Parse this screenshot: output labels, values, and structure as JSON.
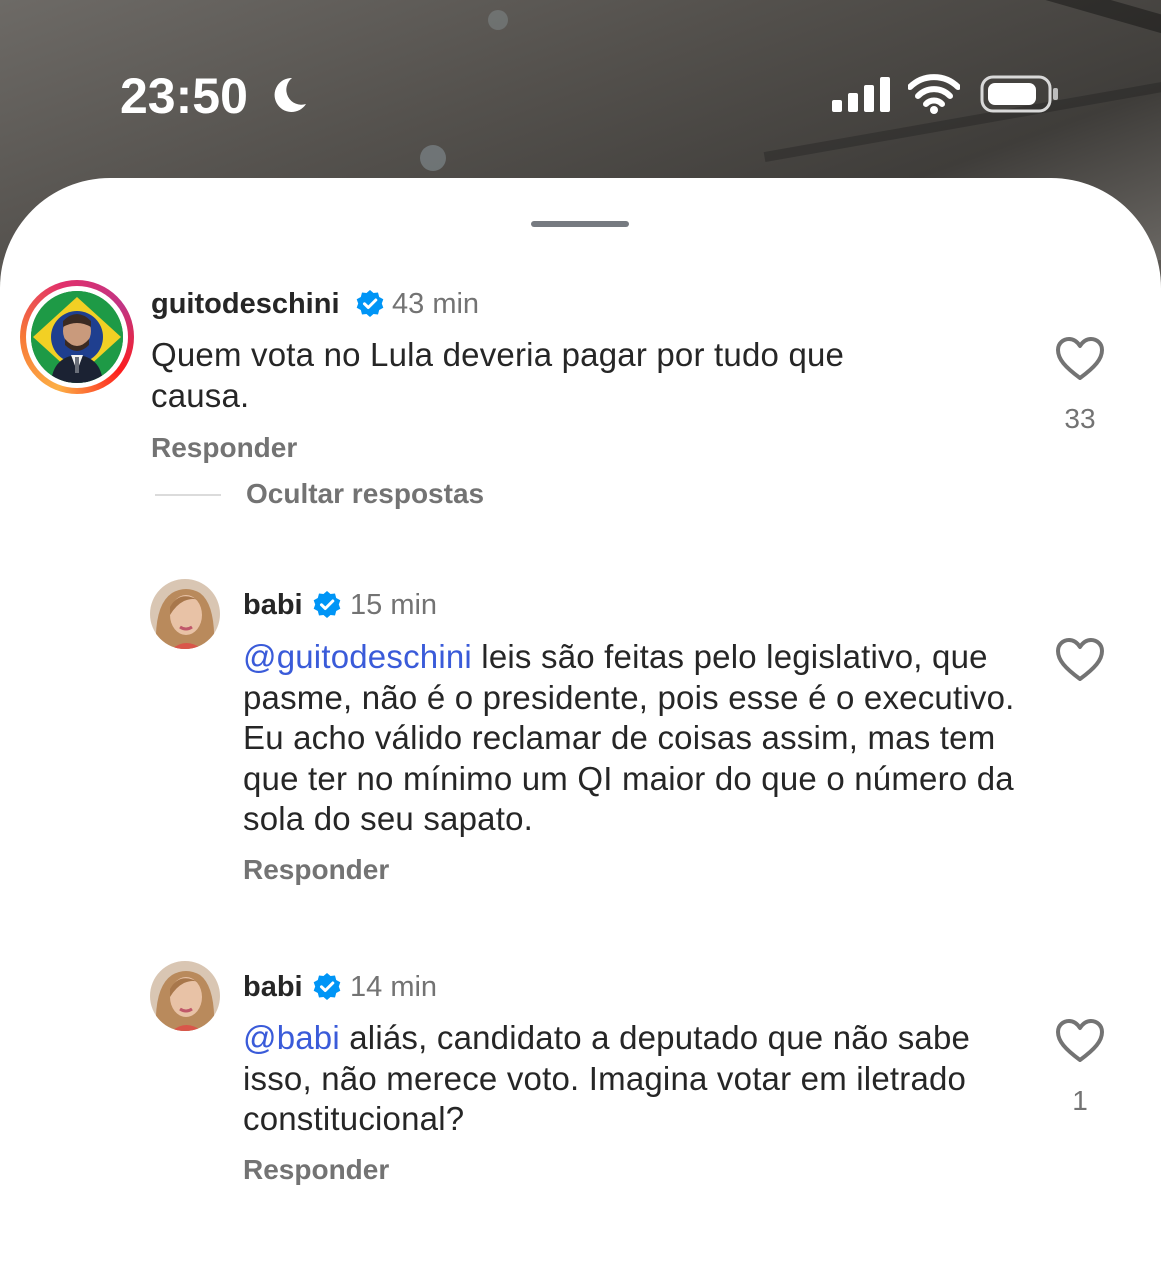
{
  "status_bar": {
    "time": "23:50",
    "icons": [
      "moon-icon",
      "cellular-signal-icon",
      "wifi-icon",
      "battery-icon"
    ]
  },
  "comments": [
    {
      "username": "guitodeschini",
      "verified": true,
      "time": "43 min",
      "mention": "",
      "text": "Quem vota no Lula deveria pagar por tudo que causa.",
      "reply_label": "Responder",
      "likes": "33"
    }
  ],
  "hide_replies_label": "Ocultar respostas",
  "replies": [
    {
      "username": "babi",
      "verified": true,
      "time": "15 min",
      "mention": "@guitodeschini",
      "text": " leis são feitas pelo legislativo, que pasme, não é o presidente, pois esse é o executivo. Eu acho válido reclamar de coisas assim, mas tem que ter no mínimo um QI maior do que o número da sola do seu sapato.",
      "reply_label": "Responder",
      "likes": ""
    },
    {
      "username": "babi",
      "verified": true,
      "time": "14 min",
      "mention": "@babi",
      "text": " aliás, candidato a deputado que não sabe isso, não merece voto. Imagina votar em iletrado constitucional?",
      "reply_label": "Responder",
      "likes": "1"
    }
  ],
  "colors": {
    "mention": "#3a5bd9",
    "verified": "#0095f6",
    "secondary_text": "#737373",
    "primary_text": "#262626"
  }
}
